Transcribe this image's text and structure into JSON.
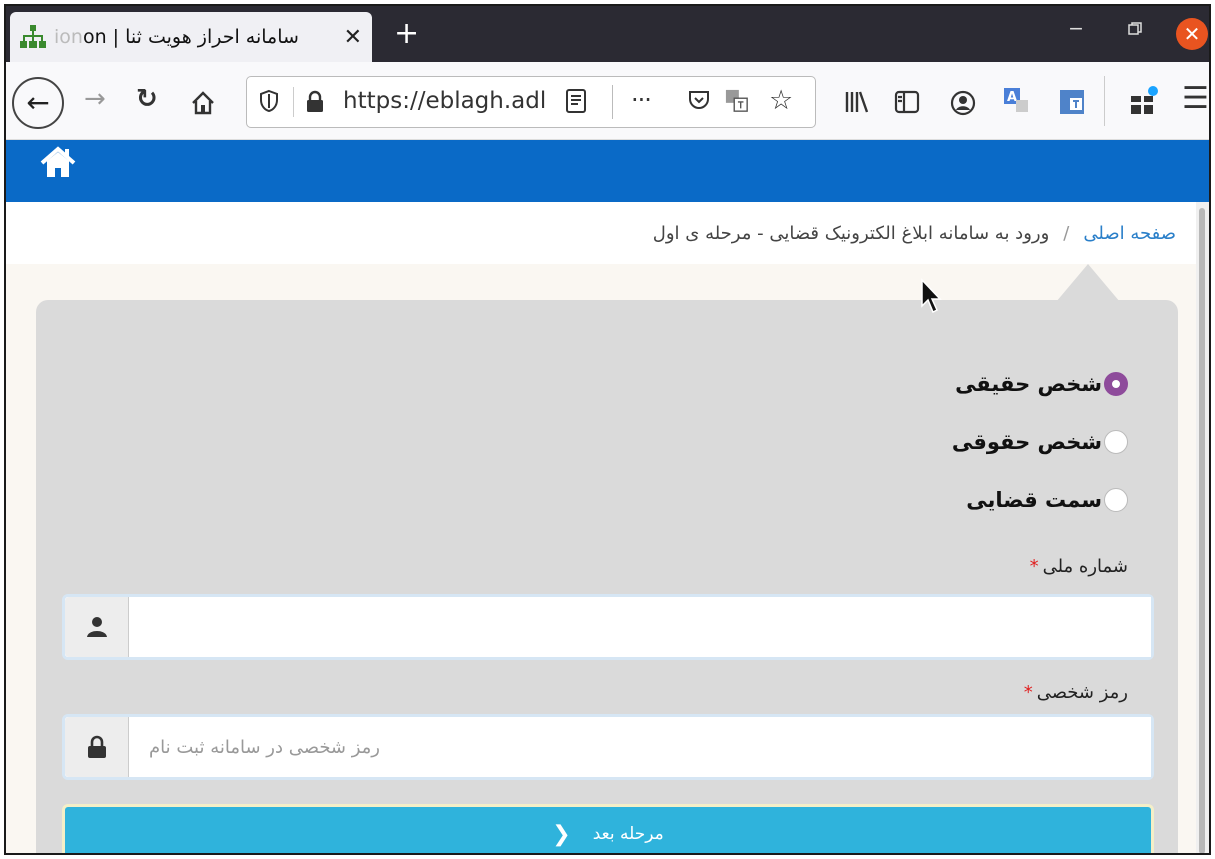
{
  "browser": {
    "tab_title_visible": "سامانه احراز هویت ثنا | ",
    "tab_title_faded": "ion",
    "tab_title_tail": "on",
    "tab_close": "✕",
    "new_tab": "+",
    "url": "https://eblagh.adl",
    "more": "···"
  },
  "breadcrumb": {
    "home": "صفحه اصلی",
    "separator": "/",
    "current": "ورود به سامانه ابلاغ الکترونیک قضایی - مرحله ی اول"
  },
  "form": {
    "radio_options": [
      {
        "label": "شخص حقیقی",
        "checked": true
      },
      {
        "label": "شخص حقوقی",
        "checked": false
      },
      {
        "label": "سمت قضایی",
        "checked": false
      }
    ],
    "national_id": {
      "label": "شماره ملی",
      "required_mark": "*",
      "value": "",
      "placeholder": ""
    },
    "password": {
      "label": "رمز شخصی",
      "required_mark": "*",
      "value": "",
      "placeholder": "رمز شخصی در سامانه ثبت نام"
    },
    "next_button": "مرحله بعد",
    "next_chevron": "❮"
  },
  "colors": {
    "header_blue": "#0a6ac7",
    "radio_checked": "#8e4b9b",
    "button_blue": "#2fb3dc",
    "required_red": "#e02020"
  }
}
